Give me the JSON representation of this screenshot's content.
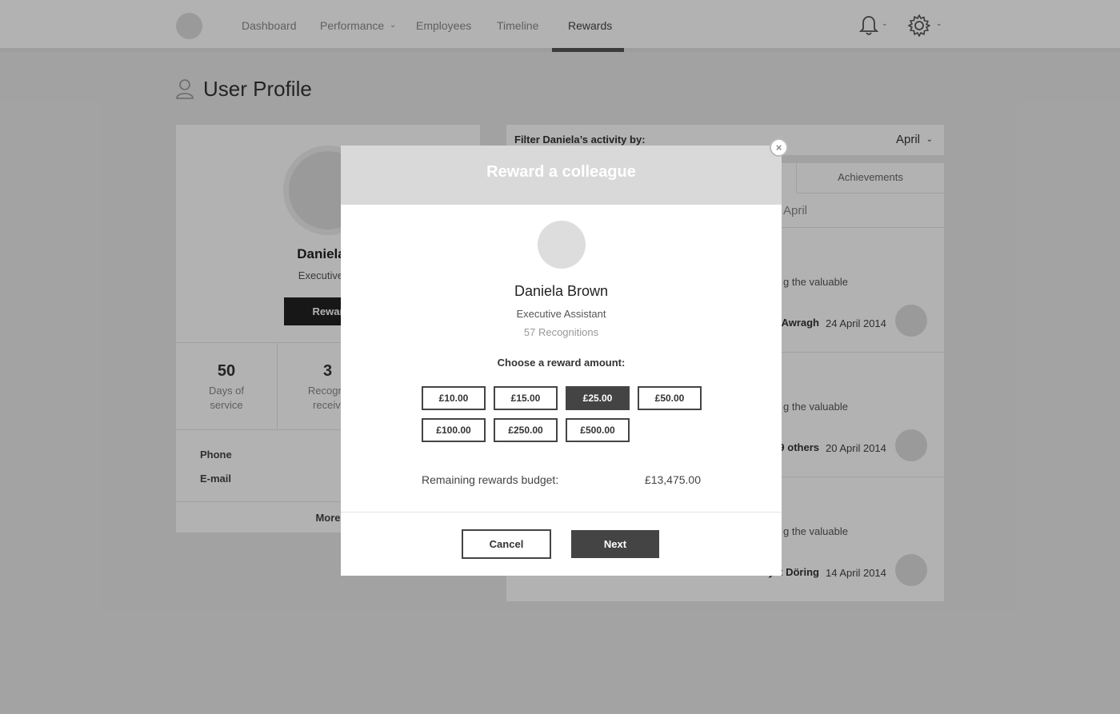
{
  "nav": {
    "items": [
      {
        "label": "Dashboard"
      },
      {
        "label": "Performance"
      },
      {
        "label": "Employees"
      },
      {
        "label": "Timeline"
      },
      {
        "label": "Rewards"
      }
    ],
    "active": "Rewards",
    "caret": "⌄",
    "icons": [
      "bell-icon",
      "gear-icon"
    ]
  },
  "page": {
    "title": "User Profile",
    "icon": "user-icon"
  },
  "profile": {
    "name": "Daniela B",
    "role": "Executive As",
    "reward_button": "Rewar",
    "stats": [
      {
        "value": "50",
        "label": "Days of service"
      },
      {
        "value": "3",
        "label": "Recogniti receive"
      }
    ],
    "contact_labels": [
      "Phone",
      "E-mail"
    ],
    "more_label": "More"
  },
  "activity": {
    "filter_label": "Filter Daniela’s activity by:",
    "filter_value": "April",
    "tab_achievements": "Achievements",
    "month_header": "April",
    "items": [
      {
        "text": "g the valuable",
        "who": "Awragh",
        "date": "24 April 2014"
      },
      {
        "text": "g the valuable",
        "who": "9 others",
        "date": "20 April 2014"
      },
      {
        "text": "g the valuable",
        "who": "y     x Döring",
        "date": "14 April 2014"
      }
    ]
  },
  "modal": {
    "title": "Reward a colleague",
    "close": "×",
    "name": "Daniela Brown",
    "role": "Executive Assistant",
    "recognitions": "57 Recognitions",
    "choose_label": "Choose a reward amount:",
    "amounts": [
      "£10.00",
      "£15.00",
      "£25.00",
      "£50.00",
      "£100.00",
      "£250.00",
      "£500.00"
    ],
    "selected_amount": "£25.00",
    "budget_label": "Remaining rewards budget:",
    "budget_value": "£13,475.00",
    "cancel_label": "Cancel",
    "next_label": "Next"
  },
  "colors": {
    "dark": "#444444",
    "overlay": "rgba(0,0,0,0.30)",
    "header": "#d9d9d9"
  }
}
